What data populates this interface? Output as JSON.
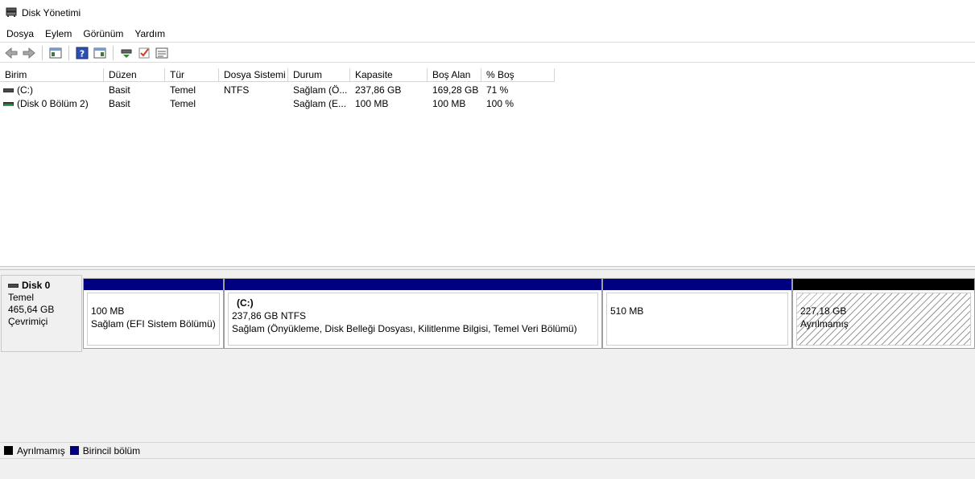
{
  "window": {
    "title": "Disk Yönetimi",
    "icon": "disk-management-icon"
  },
  "menu": [
    "Dosya",
    "Eylem",
    "Görünüm",
    "Yardım"
  ],
  "toolbar": {
    "buttons": [
      "back-arrow-icon",
      "forward-arrow-icon",
      "console-tree-icon",
      "help-icon",
      "action-pane-icon",
      "connect-icon",
      "check-icon",
      "properties-icon"
    ]
  },
  "volume_table": {
    "columns": [
      "Birim",
      "Düzen",
      "Tür",
      "Dosya Sistemi",
      "Durum",
      "Kapasite",
      "Boş Alan",
      "% Boş"
    ],
    "rows": [
      [
        "(C:)",
        "Basit",
        "Temel",
        "NTFS",
        "Sağlam (Ö...",
        "237,86 GB",
        "169,28 GB",
        "71 %"
      ],
      [
        "(Disk 0 Bölüm 2)",
        "Basit",
        "Temel",
        "",
        "Sağlam (E...",
        "100 MB",
        "100 MB",
        "100 %"
      ]
    ]
  },
  "disk": {
    "name": "Disk 0",
    "type": "Temel",
    "size": "465,64 GB",
    "status": "Çevrimiçi",
    "partitions": [
      {
        "name": "",
        "size": "100 MB",
        "status": "Sağlam (EFI Sistem Bölümü)",
        "kind": "primary"
      },
      {
        "name": "(C:)",
        "size": "237,86 GB NTFS",
        "status": "Sağlam (Önyükleme, Disk Belleği Dosyası, Kilitlenme Bilgisi, Temel Veri Bölümü)",
        "kind": "primary"
      },
      {
        "name": "",
        "size": "510 MB",
        "status": "",
        "kind": "primary"
      },
      {
        "name": "",
        "size": "227,18 GB",
        "status": "Ayrılmamış",
        "kind": "unallocated"
      }
    ]
  },
  "legend": [
    {
      "label": "Ayrılmamış",
      "color": "#000000"
    },
    {
      "label": "Birincil bölüm",
      "color": "#000080"
    }
  ],
  "colors": {
    "primary": "#000080",
    "unallocated": "#000000"
  }
}
